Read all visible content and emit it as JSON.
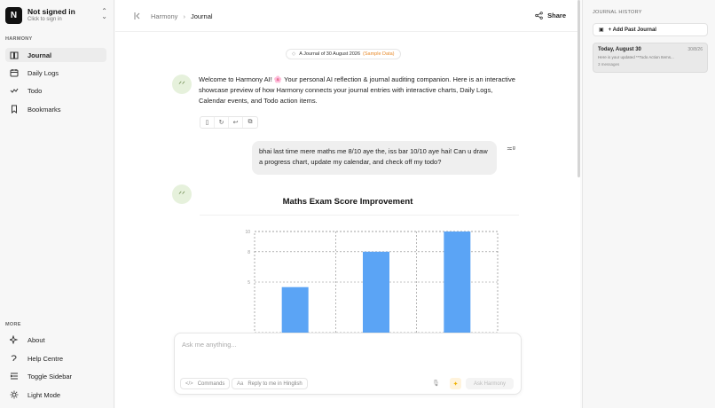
{
  "account": {
    "logo": "N",
    "name": "Not signed in",
    "subtitle": "Click to sign in"
  },
  "sidebar": {
    "section_label": "HARMONY",
    "items": [
      {
        "label": "Journal",
        "icon": "book-open-icon",
        "active": true
      },
      {
        "label": "Daily Logs",
        "icon": "calendar-icon"
      },
      {
        "label": "Todo",
        "icon": "check-icon"
      },
      {
        "label": "Bookmarks",
        "icon": "bookmark-icon"
      }
    ],
    "more_label": "MORE",
    "more_items": [
      {
        "label": "About",
        "icon": "sparkles-icon"
      },
      {
        "label": "Help Centre",
        "icon": "help-icon"
      },
      {
        "label": "Toggle Sidebar",
        "icon": "sidebar-toggle-icon"
      },
      {
        "label": "Light Mode",
        "icon": "sun-icon"
      }
    ]
  },
  "header": {
    "breadcrumb_root": "Harmony",
    "breadcrumb_current": "Journal",
    "share_label": "Share"
  },
  "conversation": {
    "date_pill": "A Journal of 30 August 2026",
    "sample_tag": "(Sample Data)",
    "assistant_message_1": "Welcome to Harmony AI! 🌸 Your personal AI reflection & journal auditing companion. Here is an interactive showcase preview of how Harmony connects your journal entries with interactive charts, Daily Logs, Calendar events, and Todo action items.",
    "user_message": "bhai last time mere maths me 8/10 aye the, iss bar 10/10 aye hai! Can u draw a progress chart, update my calendar, and check off my todo?"
  },
  "chart_data": {
    "type": "bar",
    "title": "Maths Exam Score Improvement",
    "categories": [
      "",
      "",
      ""
    ],
    "values": [
      4.5,
      8,
      10
    ],
    "ylim": [
      0,
      10
    ],
    "yticks": [
      "10",
      "8",
      "5"
    ],
    "grid": true,
    "color": "#5ba4f5"
  },
  "input": {
    "placeholder": "Ask me anything...",
    "commands_label": "Commands",
    "hinglish_label": "Reply to me in Hinglish",
    "send_label": "Ask Harmony"
  },
  "history": {
    "title": "JOURNAL HISTORY",
    "add_label": "+ Add Past Journal",
    "cards": [
      {
        "title": "Today, August 30",
        "date": "30/8/26",
        "preview": "Here is your updated **Todo Action Items...",
        "count": "3 messages"
      }
    ]
  },
  "colors": {
    "accent": "#5ba4f5",
    "sample_orange": "#e88b2d"
  }
}
